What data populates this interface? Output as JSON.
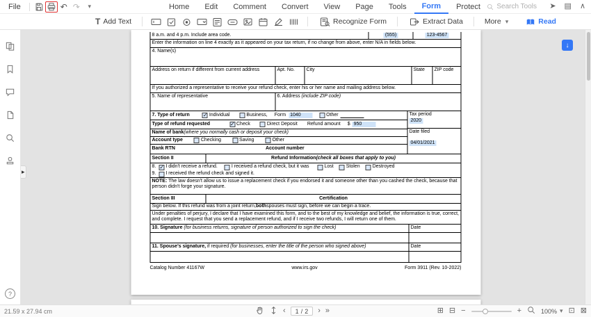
{
  "menubar": {
    "file": "File",
    "tabs": [
      "Home",
      "Edit",
      "Comment",
      "Convert",
      "View",
      "Page",
      "Tools",
      "Form",
      "Protect"
    ],
    "search": "Search Tools"
  },
  "toolbar": {
    "add_text": "Add Text",
    "recognize": "Recognize Form",
    "extract": "Extract Data",
    "more": "More",
    "read": "Read"
  },
  "icons": {
    "undo": "↶",
    "redo": "↷",
    "caret": "▾",
    "share": "➤",
    "panel": "▤",
    "collapse": "∧",
    "t": "T",
    "prev": "‹",
    "next": "›",
    "last": "»",
    "minus": "−",
    "plus": "+",
    "grid": "⊞",
    "single": "⊟",
    "fit_page": "⊡",
    "fit_width": "⊠",
    "down": "↓",
    "expand": "▸",
    "help": "?"
  },
  "doc": {
    "phone_note": "8 a.m. and 4 p.m. Include area code.",
    "phone_area": "(555)",
    "phone_num": "123-4567",
    "line4_note": "Enter the information on line 4 exactly as it appeared on your tax return, if no change from above, enter N/A in fields below.",
    "name_label": "4. Name(s)",
    "addr_label": "Address on return if different from current address",
    "apt_label": "Apt. No.",
    "city_label": "City",
    "state_label": "State",
    "zip_label": "ZIP code",
    "rep_note": "If you authorized a representative to receive your refund check, enter his or her name and mailing address below.",
    "rep_name_label": "5. Name of representative",
    "rep_addr_label": "6. Address ",
    "rep_addr_note": "(include ZIP code)",
    "tor_label": "7. Type of return",
    "tor_individual": "Individual",
    "tor_business": "Business,",
    "tor_form": "Form",
    "tor_form_val": "1040",
    "tor_other": "Other",
    "tax_period_label": "Tax period",
    "tax_period_val": "2020",
    "trr_label": "Type of refund requested",
    "trr_check": "Check",
    "trr_dd": "Direct Deposit",
    "refund_amount_label": "Refund amount",
    "dollar": "$",
    "refund_amount_val": "950",
    "bank_label": "Name of bank ",
    "bank_note": "(where you normally cash or deposit your check)",
    "date_filed_label": "Date filed",
    "date_filed_val": "04/01/2021",
    "acct_label": "Account type",
    "acct_checking": "Checking",
    "acct_saving": "Saving",
    "acct_other": "Other",
    "rtn_label": "Bank RTN",
    "acctnum_label": "Account number",
    "sec2": "Section II",
    "sec2_title": "Refund Information ",
    "sec2_note": "(check all boxes that apply to you)",
    "l8": "8.",
    "l8a": "I didn't receive a refund.",
    "l8b": "I received a refund check, but it was",
    "lost": "Lost",
    "stolen": "Stolen",
    "destroyed": "Destroyed",
    "l9": "9.",
    "l9a": "I received the refund check and signed it.",
    "note_b": "NOTE:",
    "note_t": "The law doesn't allow us to issue a replacement check if you endorsed it and someone other than you cashed the check, because that person didn't forge your signature.",
    "sec3": "Section III",
    "sec3_title": "Certification",
    "sign_note_1": "Sign below. If this refund was from a joint return, ",
    "sign_note_b": "both",
    "sign_note_2": " spouses must sign, before we can begin a trace.",
    "perjury": "Under penalties of perjury, I declare that I have examined this form, and to the best of my knowledge and belief, the information is true, correct, and complete. I request that you send a replacement refund, and if I receive two refunds, I will return one of them.",
    "sig10_b": "10. Signature ",
    "sig10_i": "(for business returns, signature of person authorized to sign the check)",
    "date1": "Date",
    "sig11_b": "11. Spouse's signature,",
    "sig11_m": " if required ",
    "sig11_i": "(for businesses, enter the title of the person who signed above)",
    "date2": "Date",
    "catalog": "Catalog Number 41167W",
    "site": "www.irs.gov",
    "formno": "Form 3911 (Rev. 10-2022)",
    "checks": {
      "individual": true,
      "business": false,
      "other_return": false,
      "check": true,
      "direct_deposit": false,
      "checking": false,
      "saving": false,
      "other_account": false,
      "no_refund": true,
      "received_check": false,
      "lost": false,
      "stolen": false,
      "destroyed": false,
      "signed": false
    }
  },
  "statusbar": {
    "dimensions": "21.59 x 27.94 cm",
    "page": "1",
    "sep": "/",
    "total": "2",
    "zoom": "100%"
  }
}
